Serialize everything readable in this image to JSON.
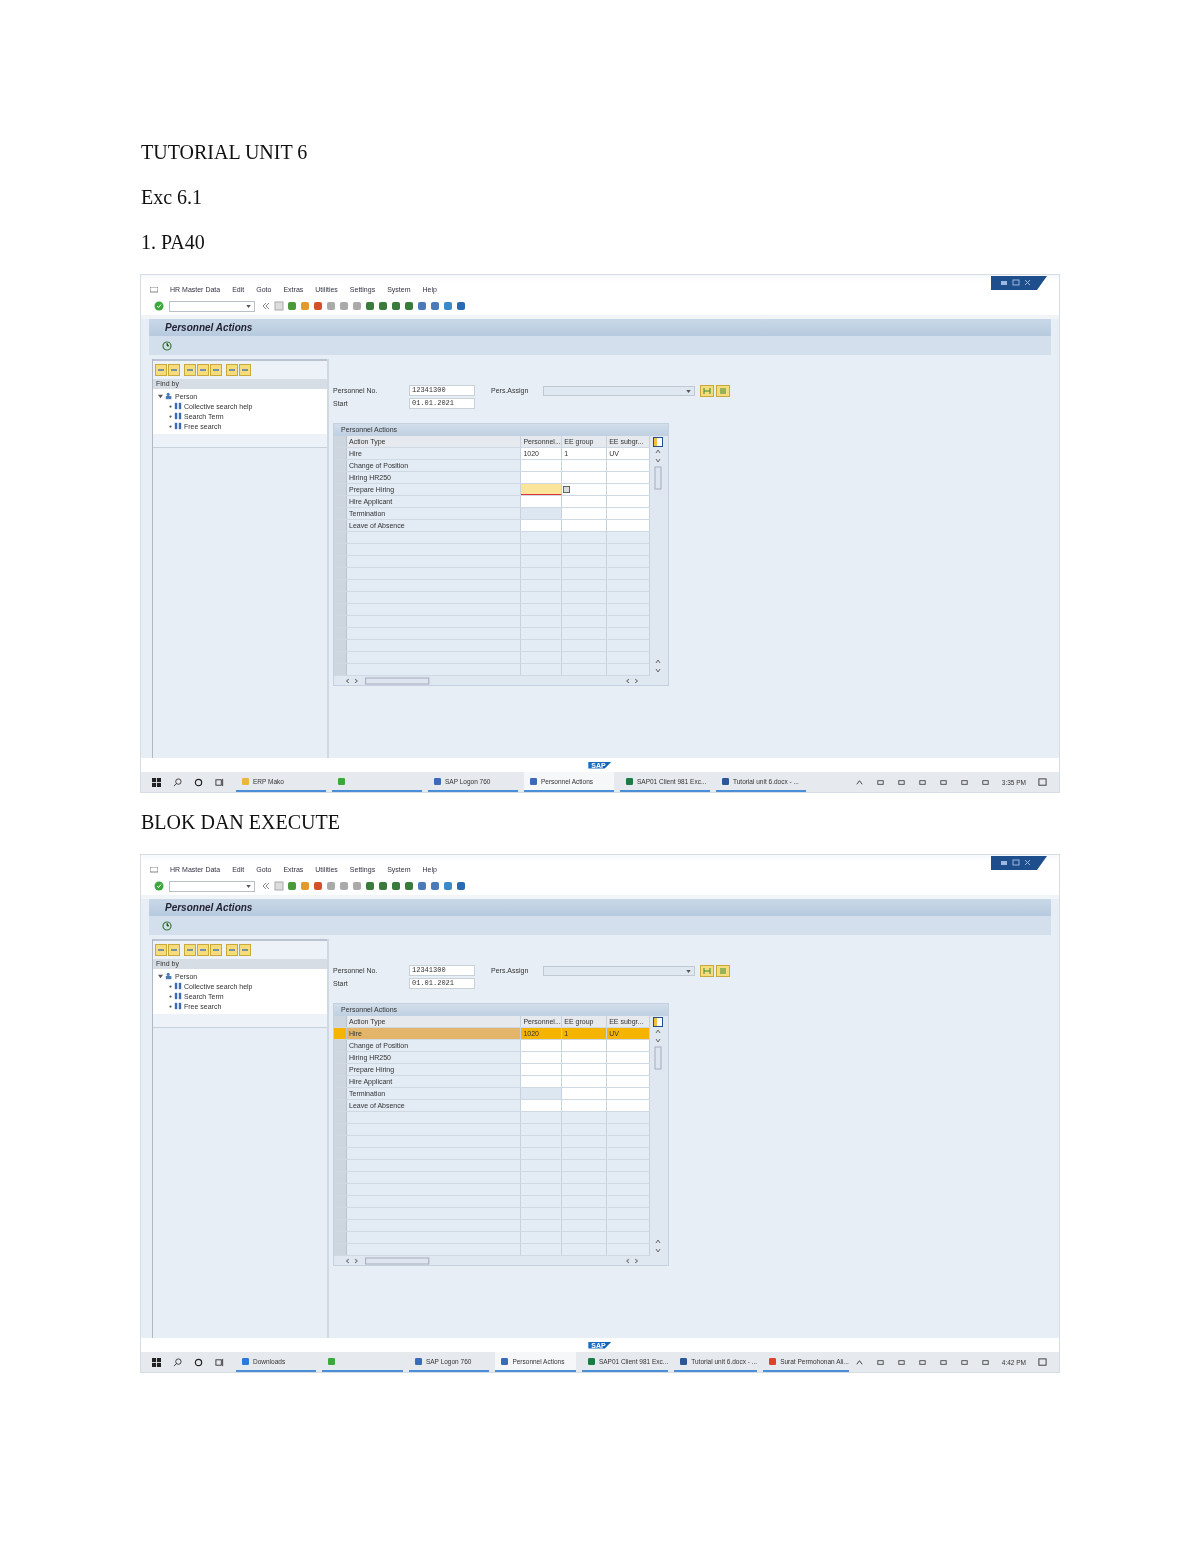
{
  "content": [
    {
      "kind": "text",
      "text": "TUTORIAL UNIT 6"
    },
    {
      "kind": "text",
      "text": "Exc 6.1"
    },
    {
      "kind": "text",
      "text": "1. PA40"
    },
    {
      "kind": "screen",
      "menu": [
        "HR Master Data",
        "Edit",
        "Goto",
        "Extras",
        "Utilities",
        "Settings",
        "System",
        "Help"
      ],
      "title": "Personnel Actions",
      "find_by": "Find by",
      "tree": {
        "label": "Person",
        "expanded": true,
        "children": [
          {
            "label": "Collective search help"
          },
          {
            "label": "Search Term"
          },
          {
            "label": "Free search"
          }
        ]
      },
      "fields": [
        {
          "label": "Personnel No.",
          "value": "12341300"
        },
        {
          "label": "Start",
          "value": "01.01.2021"
        }
      ],
      "assignment_label": "Pers.Assign",
      "table": {
        "title": "Personnel Actions",
        "columns": [
          "Action Type",
          "Personnel...",
          "EE group",
          "EE subgr..."
        ],
        "rows": [
          {
            "action": "Hire",
            "personnel": "1020",
            "ee_group": "1",
            "ee_subgroup": "UV",
            "selected": false,
            "focused": false,
            "editable": true
          },
          {
            "action": "Change of Position",
            "selected": false,
            "focused": false,
            "editable": true
          },
          {
            "action": "Hiring HR250",
            "selected": false,
            "focused": false,
            "editable": true
          },
          {
            "action": "Prepare Hiring",
            "selected": false,
            "focused": true,
            "editable": true
          },
          {
            "action": "Hire Applicant",
            "selected": false,
            "focused": false,
            "editable": true
          },
          {
            "action": "Termination",
            "selected": false,
            "focused": false,
            "editable": false
          },
          {
            "action": "Leave of Absence",
            "selected": false,
            "focused": false,
            "editable": true
          }
        ]
      },
      "logo": "SAP",
      "taskbar": [
        {
          "label": "ERP Mako",
          "kind": "folder",
          "active": false
        },
        {
          "kind": "green",
          "active": false
        },
        {
          "label": "SAP Logon 760",
          "kind": "sap",
          "active": false
        },
        {
          "label": "Personnel Actions",
          "kind": "sap",
          "active": true
        },
        {
          "label": "SAP01 Client 981 Exc...",
          "kind": "excel",
          "active": false
        },
        {
          "label": "Tutorial unit 6.docx - ...",
          "kind": "word",
          "active": false
        }
      ],
      "time": "3:35 PM"
    },
    {
      "kind": "text",
      "text": "BLOK DAN EXECUTE"
    },
    {
      "kind": "screen",
      "menu": [
        "HR Master Data",
        "Edit",
        "Goto",
        "Extras",
        "Utilities",
        "Settings",
        "System",
        "Help"
      ],
      "title": "Personnel Actions",
      "find_by": "Find by",
      "tree": {
        "label": "Person",
        "expanded": true,
        "children": [
          {
            "label": "Collective search help"
          },
          {
            "label": "Search Term"
          },
          {
            "label": "Free search"
          }
        ]
      },
      "fields": [
        {
          "label": "Personnel No.",
          "value": "12341300"
        },
        {
          "label": "Start",
          "value": "01.01.2021"
        }
      ],
      "assignment_label": "Pers.Assign",
      "table": {
        "title": "Personnel Actions",
        "columns": [
          "Action Type",
          "Personnel...",
          "EE group",
          "EE subgr..."
        ],
        "rows": [
          {
            "action": "Hire",
            "personnel": "1020",
            "ee_group": "1",
            "ee_subgroup": "UV",
            "selected": true,
            "focused": false,
            "editable": true
          },
          {
            "action": "Change of Position",
            "selected": false,
            "focused": false,
            "editable": true
          },
          {
            "action": "Hiring HR250",
            "selected": false,
            "focused": false,
            "editable": true
          },
          {
            "action": "Prepare Hiring",
            "selected": false,
            "focused": false,
            "editable": true
          },
          {
            "action": "Hire Applicant",
            "selected": false,
            "focused": false,
            "editable": true
          },
          {
            "action": "Termination",
            "selected": false,
            "focused": false,
            "editable": false
          },
          {
            "action": "Leave of Absence",
            "selected": false,
            "focused": false,
            "editable": true
          }
        ]
      },
      "logo": "SAP",
      "taskbar": [
        {
          "label": "Downloads",
          "kind": "download",
          "active": false
        },
        {
          "kind": "green",
          "active": false
        },
        {
          "label": "SAP Logon 760",
          "kind": "sap",
          "active": false
        },
        {
          "label": "Personnel Actions",
          "kind": "sap",
          "active": true
        },
        {
          "label": "SAP01 Client 981 Exc...",
          "kind": "excel",
          "active": false
        },
        {
          "label": "Tutorial unit 6.docx - ...",
          "kind": "word",
          "active": false
        },
        {
          "label": "Surat Permohonan Ali...",
          "kind": "chrome",
          "active": false
        }
      ],
      "time": "4:42 PM"
    }
  ]
}
